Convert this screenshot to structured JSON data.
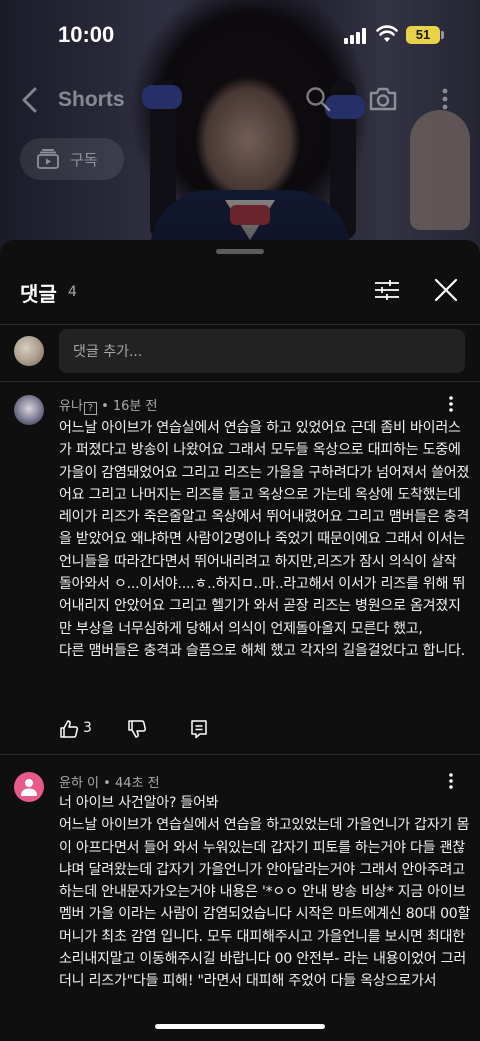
{
  "status_bar": {
    "time": "10:00",
    "battery": "51"
  },
  "header": {
    "title": "Shorts",
    "subscribe_label": "구독"
  },
  "comments_sheet": {
    "title": "댓글",
    "count": "4",
    "add_comment_placeholder": "댓글 추가...",
    "comments": [
      {
        "author": "유나",
        "badge": "?",
        "time": "• 16분 전",
        "text": "어느날 아이브가 연습실에서 연습을 하고 있었어요 근데 좀비 바이러스가 퍼졌다고 방송이 나왔어요 그래서 모두들 옥상으로 대피하는 도중에 가을이 감염돼었어요 그리고 리즈는 가을을 구하려다가 넘어져서 쓸어졌어요 그리고 나머지는 리즈를 들고 옥상으로 가는데 옥상에 도착했는데 레이가 리즈가 죽은줄알고 옥상에서 뛰어내렸어요 그리고 맴버들은 충격을 받았어요 왜냐하면 사람이2명이나 죽었기 때문이에요 그래서 이서는 언니들을 따라간다면서 뛰어내리려고 하지만,리즈가 잠시 의식이 살작 돌아와서 ㅇ...이서야....ㅎ..하지ㅁ..마..라고해서 이서가 리즈를 위해 뛰어내리지 안았어요 그리고 헬기가 와서 곧장 리즈는 병원으로 옴겨졌지만 부상을 너무심하게 당해서 의식이 언제돌아올지 모른다 했고,\n다른 맴버들은 충격과 슬픔으로 해체 했고 각자의 길을걸었다고 합니다.",
        "likes": "3"
      },
      {
        "author": "윤하 이",
        "time": "• 44초 전",
        "text": "너 아이브 사건알아? 들어봐\n어느날 아이브가 연습실에서 연습을 하고있었는데 가을언니가 갑자기 몸이 아프다면서 들어 와서  누워있는데 갑자기 피토를 하는거야 다들 괜찮냐며 달려왔는데 갑자기 가을언니가 안아달라는거야 그래서 안아주려고 하는데 안내문자가오는거야 내용은 '*ㅇㅇ 안내 방송 비상*  지금 아이브 멤버  가을 이라는 사람이 감염되었습니다 시작은 마트에계신 80대 00할머니가 최초 감염 입니다. 모두 대피해주시고 가을언니를 보시면 최대한 소리내지말고 이동해주시길 바랍니다 00  안전부- 라는 내용이었어 그러더니 리즈가\"다들 피해! \"라면서 대피해 주었어 다들 옥상으로가서"
      }
    ]
  }
}
